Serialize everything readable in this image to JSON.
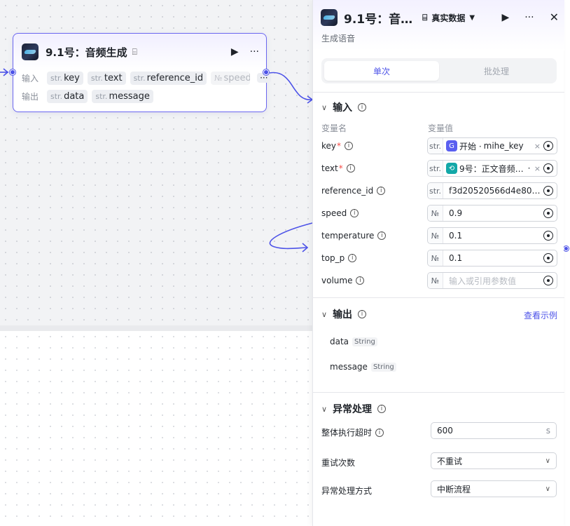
{
  "node": {
    "title": "9.1号：音频生成",
    "input_label": "输入",
    "output_label": "输出",
    "inputs": [
      {
        "type": "str.",
        "name": "key"
      },
      {
        "type": "str.",
        "name": "text"
      },
      {
        "type": "str.",
        "name": "reference_id"
      },
      {
        "type": "№",
        "name": "speed"
      }
    ],
    "more_label": "···",
    "outputs": [
      {
        "type": "str.",
        "name": "data"
      },
      {
        "type": "str.",
        "name": "message"
      }
    ]
  },
  "panel": {
    "title": "9.1号：音…",
    "run_mode_label": "真实数据",
    "subtitle": "生成语音",
    "segment": {
      "single": "单次",
      "batch": "批处理"
    },
    "input_section": {
      "title": "输入",
      "col_name": "变量名",
      "col_value": "变量值",
      "params": [
        {
          "name": "key",
          "required": true,
          "type": "str.",
          "kind": "ref",
          "ref_icon_color": "#5a5ff0",
          "ref_icon": "G",
          "ref_text": "开始 · ",
          "ref_var": "mihe_key"
        },
        {
          "name": "text",
          "required": true,
          "type": "str.",
          "kind": "ref",
          "ref_icon_color": "#13a8a8",
          "ref_icon": "⟲",
          "ref_text": "9号：正文音频…",
          "ref_var": "·"
        },
        {
          "name": "reference_id",
          "required": false,
          "type": "str.",
          "kind": "value",
          "value": "f3d20520566d4e80a…"
        },
        {
          "name": "speed",
          "required": false,
          "type": "№",
          "kind": "value",
          "value": "0.9"
        },
        {
          "name": "temperature",
          "required": false,
          "type": "№",
          "kind": "value",
          "value": "0.1"
        },
        {
          "name": "top_p",
          "required": false,
          "type": "№",
          "kind": "value",
          "value": "0.1"
        },
        {
          "name": "volume",
          "required": false,
          "type": "№",
          "kind": "placeholder",
          "value": "输入或引用参数值"
        }
      ]
    },
    "output_section": {
      "title": "输出",
      "example_link": "查看示例",
      "items": [
        {
          "name": "data",
          "type": "String"
        },
        {
          "name": "message",
          "type": "String"
        }
      ]
    },
    "error_section": {
      "title": "异常处理",
      "timeout_label": "整体执行超时",
      "timeout_value": "600",
      "timeout_unit": "s",
      "retry_label": "重试次数",
      "retry_value": "不重试",
      "mode_label": "异常处理方式",
      "mode_value": "中断流程"
    }
  },
  "colors": {
    "accent": "#4d53e8",
    "node_border": "#6a66f0",
    "required": "#f54a45"
  }
}
